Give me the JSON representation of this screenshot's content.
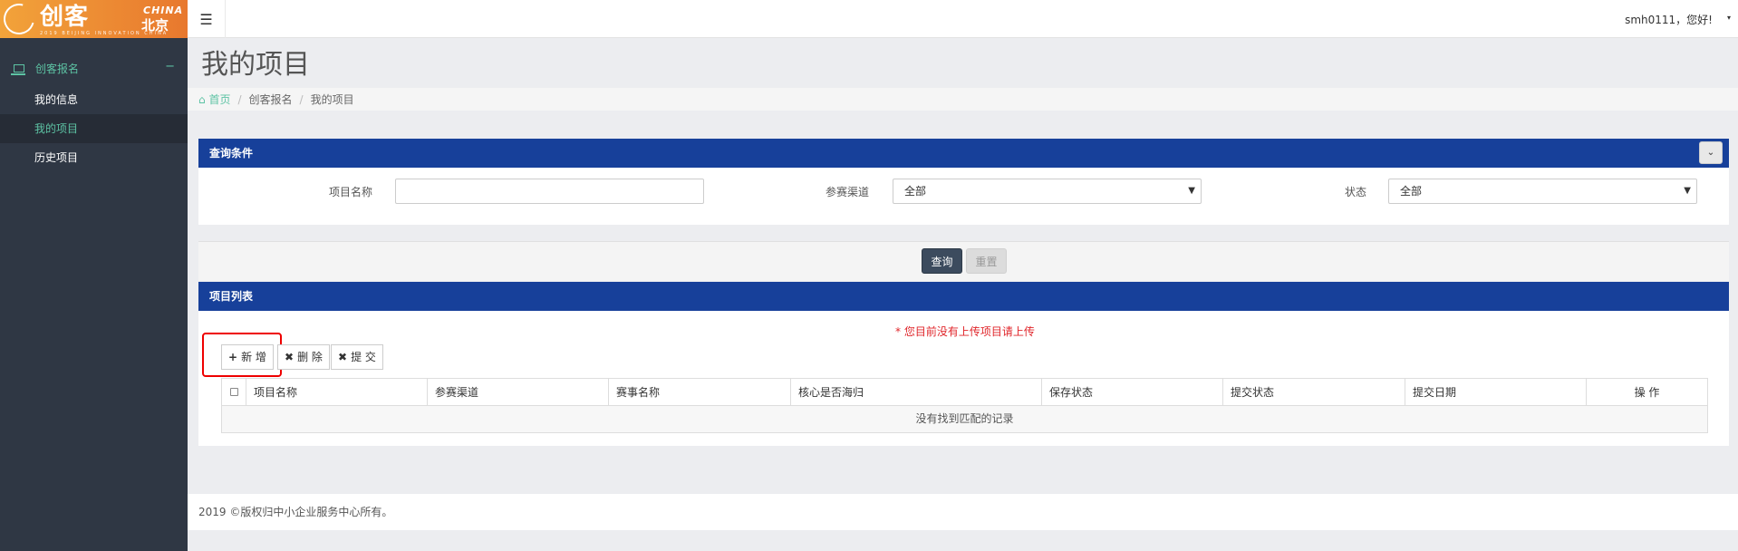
{
  "brand": {
    "logo_text": "创客",
    "logo_en": "CHINA",
    "logo_cn": "北京",
    "logo_sub": "2019  BEIJING INNOVATION  CHINA"
  },
  "sidebar": {
    "section_label": "创客报名",
    "section_toggle": "−",
    "items": [
      {
        "label": "我的信息",
        "active": false
      },
      {
        "label": "我的项目",
        "active": true
      },
      {
        "label": "历史项目",
        "active": false
      }
    ]
  },
  "header": {
    "menu_icon": "☰",
    "user_greeting": "smh0111，您好!",
    "caret": "▾"
  },
  "page": {
    "title": "我的项目",
    "breadcrumb": [
      "首页",
      "创客报名",
      "我的项目"
    ]
  },
  "query_panel": {
    "title": "查询条件",
    "toggle_icon": "⌄",
    "fields": {
      "project_name_label": "项目名称",
      "project_name_value": "",
      "channel_label": "参赛渠道",
      "channel_value": "全部",
      "status_label": "状态",
      "status_value": "全部"
    },
    "search_label": "查询",
    "reset_label": "重置"
  },
  "list_panel": {
    "title": "项目列表",
    "warning": "* 您目前没有上传项目请上传",
    "toolbar": {
      "add_label": "新 增",
      "delete_label": "删 除",
      "submit_label": "提 交"
    },
    "columns": [
      "项目名称",
      "参赛渠道",
      "赛事名称",
      "核心是否海归",
      "保存状态",
      "提交状态",
      "提交日期",
      "操 作"
    ],
    "empty_text": "没有找到匹配的记录"
  },
  "footer": {
    "text": "2019 ©版权归中小企业服务中心所有。"
  },
  "colors": {
    "sidebar_bg": "#2f3744",
    "accent_green": "#5dc3a4",
    "panel_header_blue": "#17409a",
    "warning_red": "#e0262b",
    "highlight_red": "#ee0000"
  }
}
